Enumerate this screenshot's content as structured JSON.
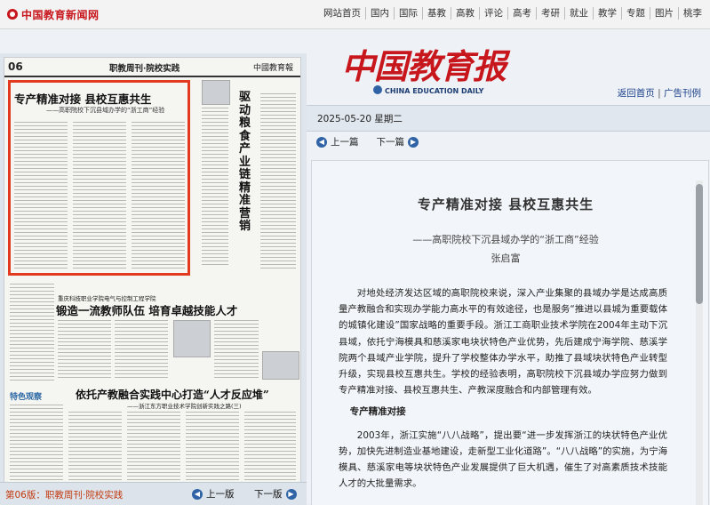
{
  "site": {
    "logo_text": "中国教育新闻网",
    "nav": [
      "网站首页",
      "国内",
      "国际",
      "基教",
      "高教",
      "评论",
      "高考",
      "考研",
      "就业",
      "教学",
      "专题",
      "图片",
      "桃李"
    ]
  },
  "masthead": {
    "title_cn": "中国教育报",
    "title_en": "CHINA EDUCATION DAILY",
    "links": [
      "返回首页",
      "广告刊例"
    ],
    "date": "2025-05-20  星期二"
  },
  "pager": {
    "prev": "上一篇",
    "next": "下一篇"
  },
  "paper_page": {
    "number": "06",
    "column": "职教周刊·院校实践",
    "brand": "中國教育報",
    "headline": "专产精准对接  县校互惠共生",
    "headline_sub": "——高职院校下沉县域办学的“浙工商”经验",
    "side_title": "驱动粮食产业链精准营销",
    "story2_kicker": "重庆科技职业学院电气与控制工程学院",
    "story2_title": "锻造一流教师队伍  培育卓越技能人才",
    "story3_title": "依托产教融合实践中心打造“人才反应堆”",
    "story3_sub": "——浙江东方职业技术学院创新实践之路(三)",
    "badge": "特色观察"
  },
  "left_footer": {
    "page_label": "第06版：职教周刊·院校实践",
    "prev": "上一版",
    "next": "下一版"
  },
  "article": {
    "title": "专产精准对接  县校互惠共生",
    "subtitle": "——高职院校下沉县域办学的“浙工商”经验",
    "author": "张启富",
    "para1": "对地处经济发达区域的高职院校来说，深入产业集聚的县域办学是达成高质量产教融合和实现办学能力高水平的有效途径，也是服务“推进以县城为重要载体的城镇化建设”国家战略的重要手段。浙江工商职业技术学院在2004年主动下沉县域，依托宁海模具和慈溪家电块状特色产业优势，先后建成宁海学院、慈溪学院两个县域产业学院，提升了学校整体办学水平，助推了县域块状特色产业转型升级，实现县校互惠共生。学校的经验表明，高职院校下沉县域办学应努力做到专产精准对接、县校互惠共生、产教深度融合和内部管理有效。",
    "section1": "专产精准对接",
    "para2": "2003年，浙江实施“八八战略”，提出要“进一步发挥浙江的块状特色产业优势，加快先进制造业基地建设，走新型工业化道路”。“八八战略”的实施，为宁海模具、慈溪家电等块状特色产业发展提供了巨大机遇，催生了对高素质技术技能人才的大批量需求。"
  },
  "colors": {
    "brand_red": "#c8161d",
    "link_blue": "#1a3f8a",
    "highlight": "#e23a1e"
  }
}
